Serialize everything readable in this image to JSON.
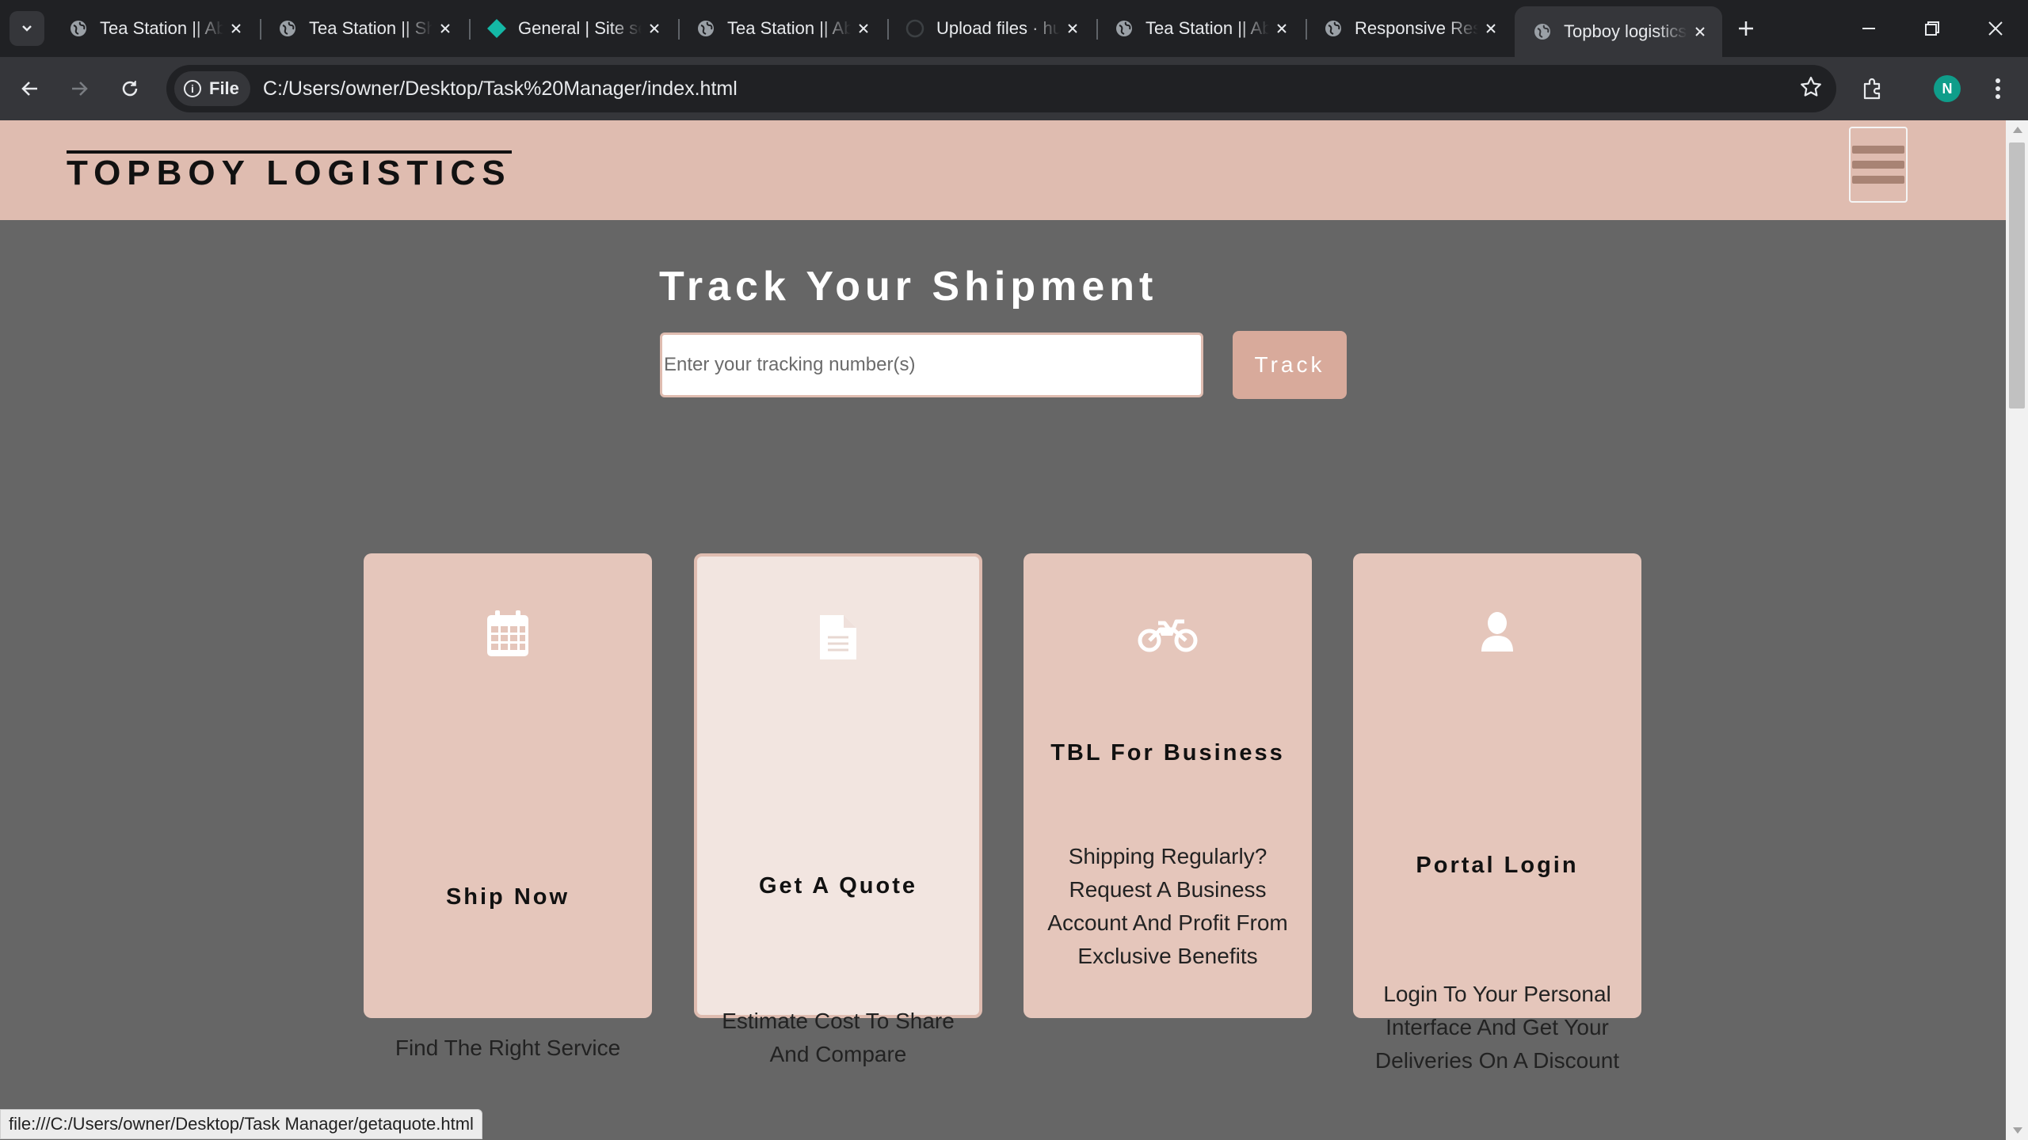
{
  "browser": {
    "tabs": [
      {
        "title": "Tea Station || About",
        "icon": "globe-icon",
        "active": false
      },
      {
        "title": "Tea Station || Shop",
        "icon": "globe-icon",
        "active": false
      },
      {
        "title": "General | Site settings",
        "icon": "netlify-icon",
        "active": false
      },
      {
        "title": "Tea Station || About",
        "icon": "globe-icon",
        "active": false
      },
      {
        "title": "Upload files · hub",
        "icon": "github-icon",
        "active": false
      },
      {
        "title": "Tea Station || About",
        "icon": "globe-icon",
        "active": false
      },
      {
        "title": "Responsive Restaurant",
        "icon": "globe-icon",
        "active": false
      },
      {
        "title": "Topboy logistics",
        "icon": "globe-icon",
        "active": true
      }
    ],
    "address": {
      "chip_label": "File",
      "url": "C:/Users/owner/Desktop/Task%20Manager/index.html"
    },
    "profile_initial": "N",
    "status_url": "file:///C:/Users/owner/Desktop/Task Manager/getaquote.html"
  },
  "site": {
    "brand": "TOPBOY LOGISTICS",
    "track": {
      "title": "Track Your Shipment",
      "placeholder": "Enter your tracking number(s)",
      "button": "Track"
    },
    "cards": [
      {
        "icon": "calendar-icon",
        "title": "Ship Now",
        "text": "Find The Right Service"
      },
      {
        "icon": "document-icon",
        "title": "Get A Quote",
        "text": "Estimate Cost To Share And Compare"
      },
      {
        "icon": "motorcycle-icon",
        "title": "TBL For Business",
        "text": "Shipping Regularly? Request A Business Account And Profit From Exclusive Benefits"
      },
      {
        "icon": "user-icon",
        "title": "Portal Login",
        "text": "Login To Your Personal Interface And Get Your Deliveries On A Discount"
      }
    ]
  },
  "colors": {
    "header_bg": "#dfbcb0",
    "page_bg": "#666666",
    "card_bg": "#e5c6bb",
    "card_hover_bg": "#f2e5e0",
    "button_bg": "#d8aa9b",
    "hamburger_bar": "#a88374"
  }
}
